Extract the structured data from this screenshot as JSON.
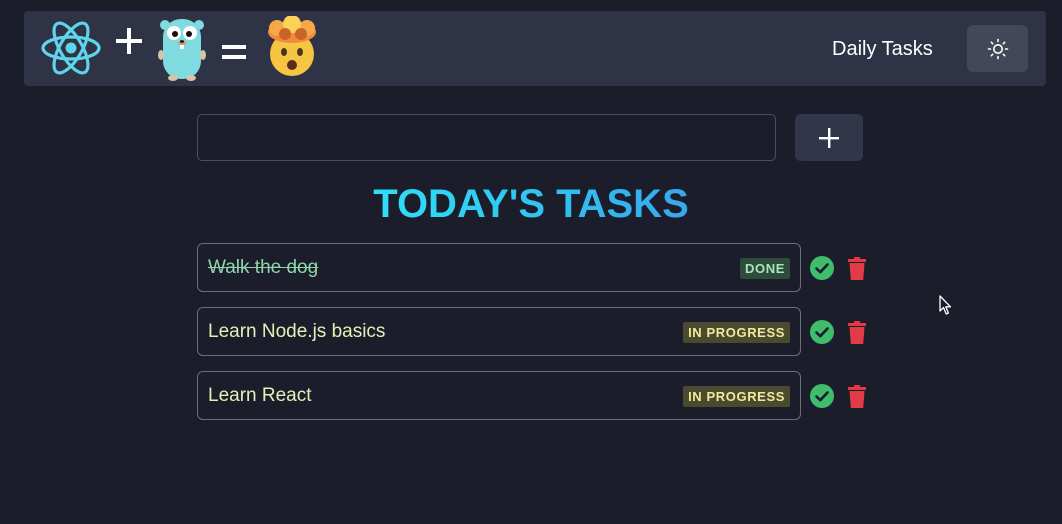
{
  "navbar": {
    "title": "Daily Tasks",
    "logos": [
      "react-logo",
      "plus-sign",
      "gopher-mascot",
      "equals-sign",
      "mind-blown-emoji"
    ],
    "theme_toggle_icon": "sun-icon"
  },
  "composer": {
    "input_value": "",
    "input_placeholder": "",
    "add_icon": "plus-icon"
  },
  "heading": "TODAY'S TASKS",
  "tasks": [
    {
      "text": "Walk the dog",
      "status": "DONE",
      "completed": true
    },
    {
      "text": "Learn Node.js basics",
      "status": "IN PROGRESS",
      "completed": false
    },
    {
      "text": "Learn React",
      "status": "IN PROGRESS",
      "completed": false
    }
  ],
  "colors": {
    "background": "#1b1d2a",
    "navbar": "#2e3345",
    "accent_cyan": "#2ee0f7",
    "check_green": "#3fbd6a",
    "trash_red": "#e23a47",
    "done_badge_bg": "#2e4b3c",
    "progress_badge_bg": "#4b4a2f"
  }
}
